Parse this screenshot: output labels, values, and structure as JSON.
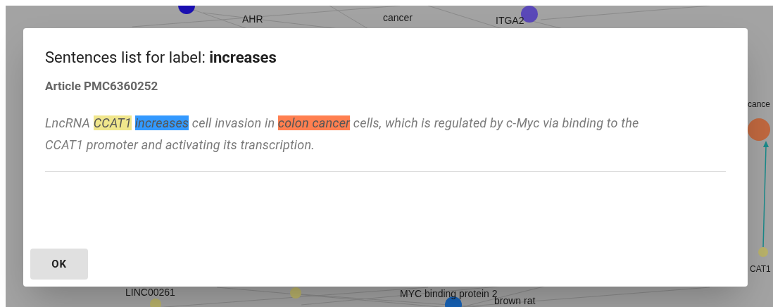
{
  "graph": {
    "labels": [
      "AHR",
      "cancer",
      "ITGA2",
      "cance",
      "CAT1",
      "LINC00261",
      "MYC binding protein 2",
      "brown rat"
    ]
  },
  "dialog": {
    "title": "Sentences list for label: **increases**",
    "article": "Article PMC6360252",
    "sentence": [
      {
        "text": "LncRNA "
      },
      {
        "text": "CCAT1",
        "color": "#f0e68c"
      },
      {
        "text": "increases",
        "color": "#3399ff"
      },
      {
        "text": " cell invasion in "
      },
      {
        "text": "colon cancer",
        "color": "#ff7f50"
      },
      {
        "text": " cells, which is regulated by c-Myc via binding to the CCAT1 promoter and activating its transcription."
      }
    ],
    "buttons": [
      "OK"
    ]
  }
}
